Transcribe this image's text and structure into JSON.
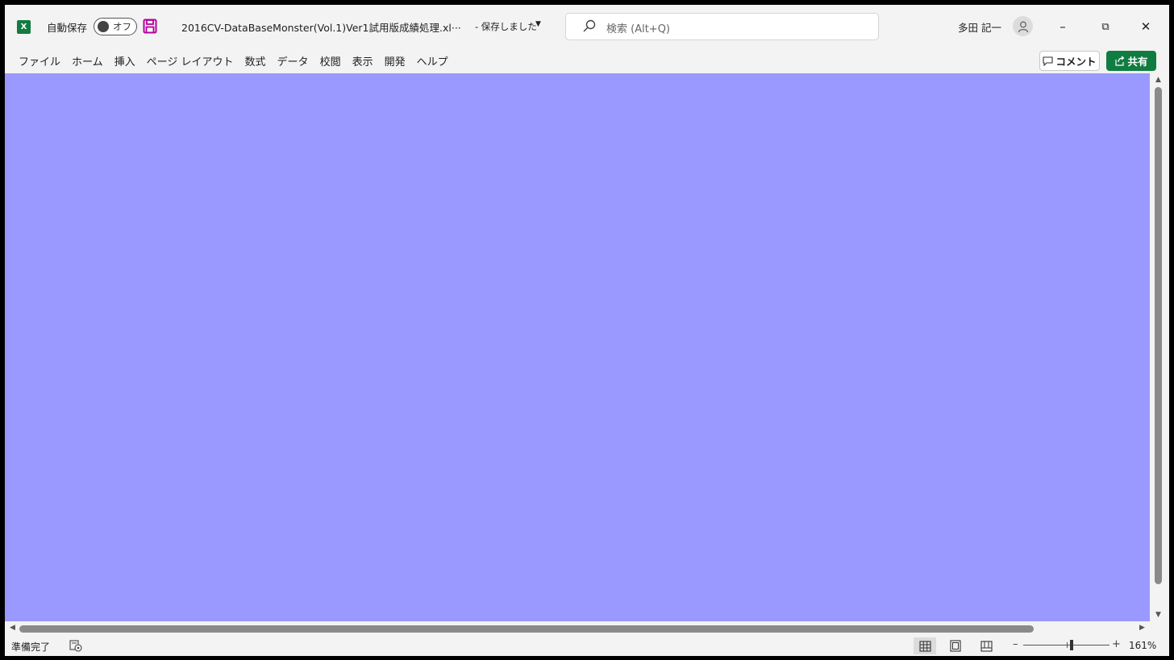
{
  "titlebar": {
    "app_icon_letter": "X",
    "autosave_label": "自動保存",
    "autosave_toggle": "オフ",
    "filename": "2016CV-DataBaseMonster(Vol.1)Ver1試用版成績処理.xl···",
    "saved_status": "- 保存しました",
    "search_placeholder": "検索 (Alt+Q)",
    "username": "多田 記一",
    "minimize": "–",
    "restore": "⧉",
    "close": "✕"
  },
  "ribbon": {
    "tabs": [
      "ファイル",
      "ホーム",
      "挿入",
      "ページ レイアウト",
      "数式",
      "データ",
      "校閲",
      "表示",
      "開発",
      "ヘルプ"
    ],
    "comment_label": "コメント",
    "share_label": "共有"
  },
  "sheet": {
    "background_color": "#9999ff"
  },
  "statusbar": {
    "status": "準備完了",
    "zoom": "161%"
  },
  "colors": {
    "accent": "#107c41",
    "save_icon": "#b4009e"
  },
  "icons": [
    "excel-logo-icon",
    "save-icon",
    "search-icon",
    "avatar-icon",
    "comment-icon",
    "share-icon",
    "accessibility-icon",
    "normal-view-icon",
    "page-layout-view-icon",
    "page-break-view-icon"
  ]
}
